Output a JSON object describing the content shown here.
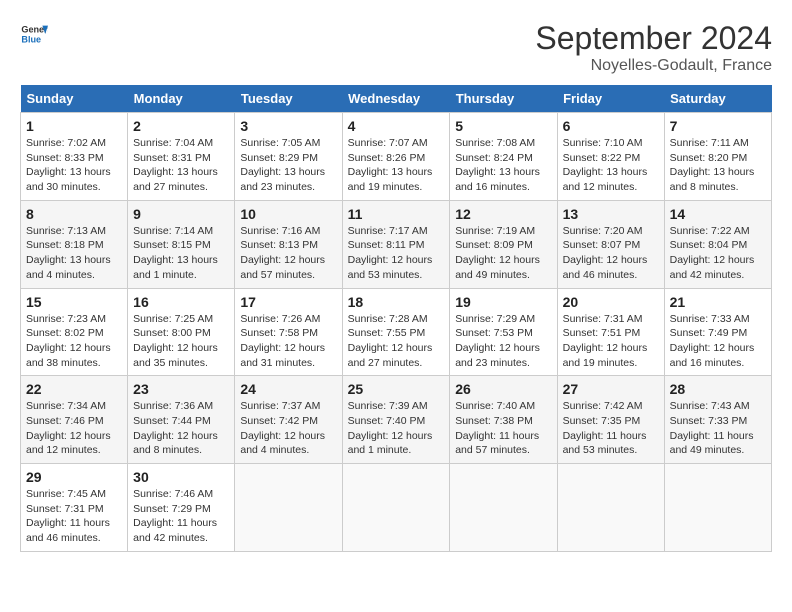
{
  "header": {
    "logo_line1": "General",
    "logo_line2": "Blue",
    "month_title": "September 2024",
    "subtitle": "Noyelles-Godault, France"
  },
  "weekdays": [
    "Sunday",
    "Monday",
    "Tuesday",
    "Wednesday",
    "Thursday",
    "Friday",
    "Saturday"
  ],
  "weeks": [
    [
      {
        "day": "1",
        "info": "Sunrise: 7:02 AM\nSunset: 8:33 PM\nDaylight: 13 hours\nand 30 minutes."
      },
      {
        "day": "2",
        "info": "Sunrise: 7:04 AM\nSunset: 8:31 PM\nDaylight: 13 hours\nand 27 minutes."
      },
      {
        "day": "3",
        "info": "Sunrise: 7:05 AM\nSunset: 8:29 PM\nDaylight: 13 hours\nand 23 minutes."
      },
      {
        "day": "4",
        "info": "Sunrise: 7:07 AM\nSunset: 8:26 PM\nDaylight: 13 hours\nand 19 minutes."
      },
      {
        "day": "5",
        "info": "Sunrise: 7:08 AM\nSunset: 8:24 PM\nDaylight: 13 hours\nand 16 minutes."
      },
      {
        "day": "6",
        "info": "Sunrise: 7:10 AM\nSunset: 8:22 PM\nDaylight: 13 hours\nand 12 minutes."
      },
      {
        "day": "7",
        "info": "Sunrise: 7:11 AM\nSunset: 8:20 PM\nDaylight: 13 hours\nand 8 minutes."
      }
    ],
    [
      {
        "day": "8",
        "info": "Sunrise: 7:13 AM\nSunset: 8:18 PM\nDaylight: 13 hours\nand 4 minutes."
      },
      {
        "day": "9",
        "info": "Sunrise: 7:14 AM\nSunset: 8:15 PM\nDaylight: 13 hours\nand 1 minute."
      },
      {
        "day": "10",
        "info": "Sunrise: 7:16 AM\nSunset: 8:13 PM\nDaylight: 12 hours\nand 57 minutes."
      },
      {
        "day": "11",
        "info": "Sunrise: 7:17 AM\nSunset: 8:11 PM\nDaylight: 12 hours\nand 53 minutes."
      },
      {
        "day": "12",
        "info": "Sunrise: 7:19 AM\nSunset: 8:09 PM\nDaylight: 12 hours\nand 49 minutes."
      },
      {
        "day": "13",
        "info": "Sunrise: 7:20 AM\nSunset: 8:07 PM\nDaylight: 12 hours\nand 46 minutes."
      },
      {
        "day": "14",
        "info": "Sunrise: 7:22 AM\nSunset: 8:04 PM\nDaylight: 12 hours\nand 42 minutes."
      }
    ],
    [
      {
        "day": "15",
        "info": "Sunrise: 7:23 AM\nSunset: 8:02 PM\nDaylight: 12 hours\nand 38 minutes."
      },
      {
        "day": "16",
        "info": "Sunrise: 7:25 AM\nSunset: 8:00 PM\nDaylight: 12 hours\nand 35 minutes."
      },
      {
        "day": "17",
        "info": "Sunrise: 7:26 AM\nSunset: 7:58 PM\nDaylight: 12 hours\nand 31 minutes."
      },
      {
        "day": "18",
        "info": "Sunrise: 7:28 AM\nSunset: 7:55 PM\nDaylight: 12 hours\nand 27 minutes."
      },
      {
        "day": "19",
        "info": "Sunrise: 7:29 AM\nSunset: 7:53 PM\nDaylight: 12 hours\nand 23 minutes."
      },
      {
        "day": "20",
        "info": "Sunrise: 7:31 AM\nSunset: 7:51 PM\nDaylight: 12 hours\nand 19 minutes."
      },
      {
        "day": "21",
        "info": "Sunrise: 7:33 AM\nSunset: 7:49 PM\nDaylight: 12 hours\nand 16 minutes."
      }
    ],
    [
      {
        "day": "22",
        "info": "Sunrise: 7:34 AM\nSunset: 7:46 PM\nDaylight: 12 hours\nand 12 minutes."
      },
      {
        "day": "23",
        "info": "Sunrise: 7:36 AM\nSunset: 7:44 PM\nDaylight: 12 hours\nand 8 minutes."
      },
      {
        "day": "24",
        "info": "Sunrise: 7:37 AM\nSunset: 7:42 PM\nDaylight: 12 hours\nand 4 minutes."
      },
      {
        "day": "25",
        "info": "Sunrise: 7:39 AM\nSunset: 7:40 PM\nDaylight: 12 hours\nand 1 minute."
      },
      {
        "day": "26",
        "info": "Sunrise: 7:40 AM\nSunset: 7:38 PM\nDaylight: 11 hours\nand 57 minutes."
      },
      {
        "day": "27",
        "info": "Sunrise: 7:42 AM\nSunset: 7:35 PM\nDaylight: 11 hours\nand 53 minutes."
      },
      {
        "day": "28",
        "info": "Sunrise: 7:43 AM\nSunset: 7:33 PM\nDaylight: 11 hours\nand 49 minutes."
      }
    ],
    [
      {
        "day": "29",
        "info": "Sunrise: 7:45 AM\nSunset: 7:31 PM\nDaylight: 11 hours\nand 46 minutes."
      },
      {
        "day": "30",
        "info": "Sunrise: 7:46 AM\nSunset: 7:29 PM\nDaylight: 11 hours\nand 42 minutes."
      },
      {
        "day": "",
        "info": ""
      },
      {
        "day": "",
        "info": ""
      },
      {
        "day": "",
        "info": ""
      },
      {
        "day": "",
        "info": ""
      },
      {
        "day": "",
        "info": ""
      }
    ]
  ]
}
